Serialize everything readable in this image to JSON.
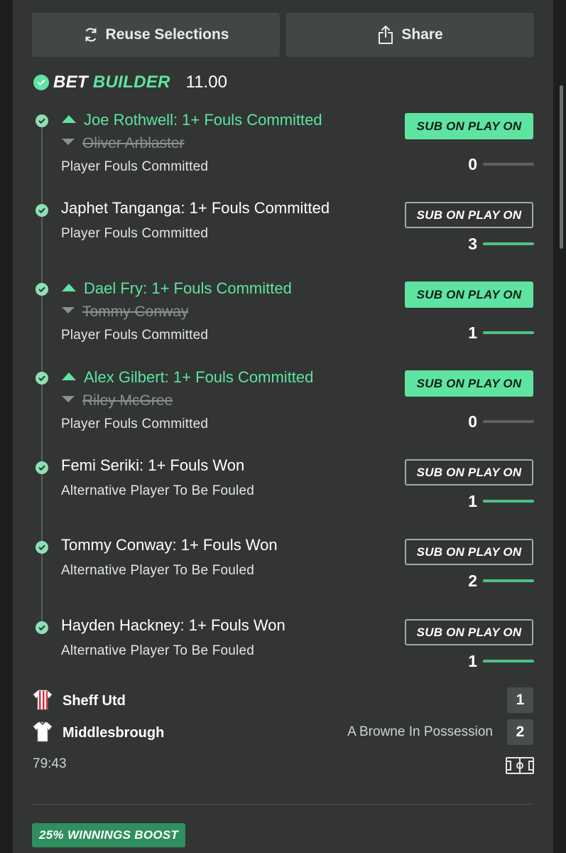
{
  "toolbar": {
    "reuse_label": "Reuse Selections",
    "share_label": "Share"
  },
  "bet_builder": {
    "title_part1": "BET",
    "title_part2": "BUILDER",
    "odds": "11.00"
  },
  "legs": [
    {
      "selection": "Joe Rothwell: 1+ Fouls Committed",
      "replaced": "Oliver Arblaster",
      "market": "Player Fouls Committed",
      "badge": "SUB ON PLAY ON",
      "badge_active": true,
      "stat": "0",
      "progress": 0
    },
    {
      "selection": "Japhet Tanganga: 1+ Fouls Committed",
      "replaced": "",
      "market": "Player Fouls Committed",
      "badge": "SUB ON PLAY ON",
      "badge_active": false,
      "stat": "3",
      "progress": 1
    },
    {
      "selection": "Dael Fry: 1+ Fouls Committed",
      "replaced": "Tommy Conway",
      "market": "Player Fouls Committed",
      "badge": "SUB ON PLAY ON",
      "badge_active": true,
      "stat": "1",
      "progress": 1
    },
    {
      "selection": "Alex Gilbert: 1+ Fouls Committed",
      "replaced": "Riley McGree",
      "market": "Player Fouls Committed",
      "badge": "SUB ON PLAY ON",
      "badge_active": true,
      "stat": "0",
      "progress": 0
    },
    {
      "selection": "Femi Seriki: 1+ Fouls Won",
      "replaced": "",
      "market": "Alternative Player To Be Fouled",
      "badge": "SUB ON PLAY ON",
      "badge_active": false,
      "stat": "1",
      "progress": 1
    },
    {
      "selection": "Tommy Conway: 1+ Fouls Won",
      "replaced": "",
      "market": "Alternative Player To Be Fouled",
      "badge": "SUB ON PLAY ON",
      "badge_active": false,
      "stat": "2",
      "progress": 1
    },
    {
      "selection": "Hayden Hackney: 1+ Fouls Won",
      "replaced": "",
      "market": "Alternative Player To Be Fouled",
      "badge": "SUB ON PLAY ON",
      "badge_active": false,
      "stat": "1",
      "progress": 1
    }
  ],
  "match": {
    "home": {
      "name": "Sheff Utd",
      "score": "1"
    },
    "away": {
      "name": "Middlesbrough",
      "score": "2"
    },
    "possession": "A Browne In Possession",
    "clock": "79:43"
  },
  "promo": {
    "boost_label": "25% WINNINGS BOOST"
  },
  "colors": {
    "accent": "#5fe3a1",
    "background": "#323533",
    "button": "#434744"
  }
}
